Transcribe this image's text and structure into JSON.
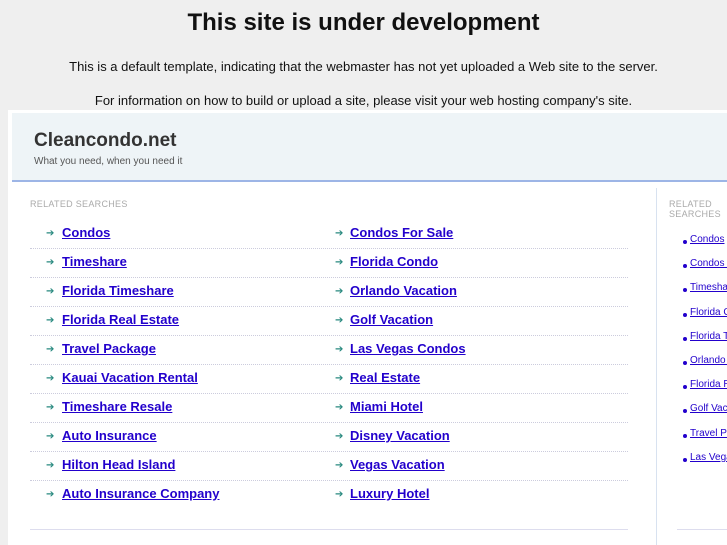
{
  "title": "This site is under development",
  "message1": "This is a default template, indicating that the webmaster has not yet uploaded a Web site to the server.",
  "message2": "For information on how to build or upload a site, please visit your web hosting company's site.",
  "site": {
    "name": "Cleancondo.net",
    "tagline": "What you need, when you need it"
  },
  "related_label": "RELATED SEARCHES",
  "links_left": [
    "Condos",
    "Timeshare",
    "Florida Timeshare",
    "Florida Real Estate",
    "Travel Package",
    "Kauai Vacation Rental",
    "Timeshare Resale",
    "Auto Insurance",
    "Hilton Head Island",
    "Auto Insurance Company"
  ],
  "links_right": [
    "Condos For Sale",
    "Florida Condo",
    "Orlando Vacation",
    "Golf Vacation",
    "Las Vegas Condos",
    "Real Estate",
    "Miami Hotel",
    "Disney Vacation",
    "Vegas Vacation",
    "Luxury Hotel"
  ],
  "sidebar_label": "RELATED SEARCHES",
  "sidebar_links": [
    "Condos",
    "Condos For Sale",
    "Timeshare",
    "Florida Condo",
    "Florida Timeshare",
    "Orlando Vacation",
    "Florida Real Estate",
    "Golf Vacation",
    "Travel Package",
    "Las Vegas Condos"
  ]
}
